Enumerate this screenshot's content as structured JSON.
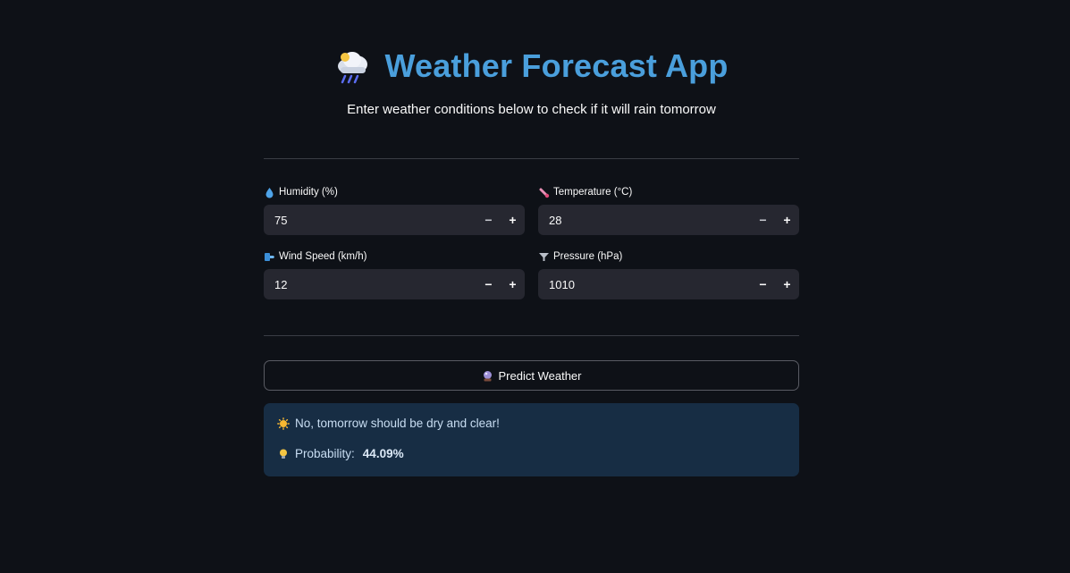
{
  "header": {
    "title": "Weather Forecast App",
    "title_icon": "cloud-rain-icon",
    "subtitle": "Enter weather conditions below to check if it will rain tomorrow"
  },
  "inputs": {
    "humidity": {
      "label": "Humidity (%)",
      "value": "75",
      "icon": "droplet-icon"
    },
    "temperature": {
      "label": "Temperature (°C)",
      "value": "28",
      "icon": "thermometer-icon"
    },
    "wind_speed": {
      "label": "Wind Speed (km/h)",
      "value": "12",
      "icon": "wind-icon"
    },
    "pressure": {
      "label": "Pressure (hPa)",
      "value": "1010",
      "icon": "funnel-icon"
    }
  },
  "stepper": {
    "minus": "−",
    "plus": "+"
  },
  "predict_button": {
    "label": "Predict Weather",
    "icon": "crystal-ball-icon"
  },
  "result": {
    "message": "No, tomorrow should be dry and clear!",
    "message_icon": "sun-icon",
    "probability_label": "Probability:",
    "probability_value": "44.09%",
    "probability_icon": "lightbulb-icon"
  },
  "colors": {
    "background": "#0e1117",
    "title": "#4a9fdc",
    "input_bg": "#262730",
    "result_bg": "#172d44",
    "result_text": "#c9def3"
  }
}
